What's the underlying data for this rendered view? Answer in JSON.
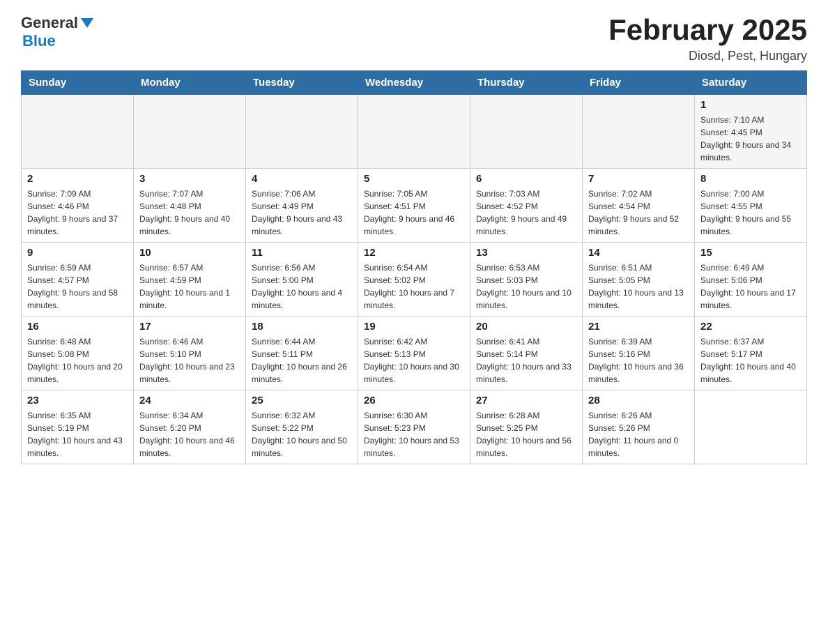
{
  "header": {
    "logo": {
      "general": "General",
      "arrow": "▶",
      "blue": "Blue"
    },
    "title": "February 2025",
    "location": "Diosd, Pest, Hungary"
  },
  "weekdays": [
    "Sunday",
    "Monday",
    "Tuesday",
    "Wednesday",
    "Thursday",
    "Friday",
    "Saturday"
  ],
  "weeks": [
    {
      "days": [
        {
          "number": "",
          "info": ""
        },
        {
          "number": "",
          "info": ""
        },
        {
          "number": "",
          "info": ""
        },
        {
          "number": "",
          "info": ""
        },
        {
          "number": "",
          "info": ""
        },
        {
          "number": "",
          "info": ""
        },
        {
          "number": "1",
          "info": "Sunrise: 7:10 AM\nSunset: 4:45 PM\nDaylight: 9 hours and 34 minutes."
        }
      ]
    },
    {
      "days": [
        {
          "number": "2",
          "info": "Sunrise: 7:09 AM\nSunset: 4:46 PM\nDaylight: 9 hours and 37 minutes."
        },
        {
          "number": "3",
          "info": "Sunrise: 7:07 AM\nSunset: 4:48 PM\nDaylight: 9 hours and 40 minutes."
        },
        {
          "number": "4",
          "info": "Sunrise: 7:06 AM\nSunset: 4:49 PM\nDaylight: 9 hours and 43 minutes."
        },
        {
          "number": "5",
          "info": "Sunrise: 7:05 AM\nSunset: 4:51 PM\nDaylight: 9 hours and 46 minutes."
        },
        {
          "number": "6",
          "info": "Sunrise: 7:03 AM\nSunset: 4:52 PM\nDaylight: 9 hours and 49 minutes."
        },
        {
          "number": "7",
          "info": "Sunrise: 7:02 AM\nSunset: 4:54 PM\nDaylight: 9 hours and 52 minutes."
        },
        {
          "number": "8",
          "info": "Sunrise: 7:00 AM\nSunset: 4:55 PM\nDaylight: 9 hours and 55 minutes."
        }
      ]
    },
    {
      "days": [
        {
          "number": "9",
          "info": "Sunrise: 6:59 AM\nSunset: 4:57 PM\nDaylight: 9 hours and 58 minutes."
        },
        {
          "number": "10",
          "info": "Sunrise: 6:57 AM\nSunset: 4:59 PM\nDaylight: 10 hours and 1 minute."
        },
        {
          "number": "11",
          "info": "Sunrise: 6:56 AM\nSunset: 5:00 PM\nDaylight: 10 hours and 4 minutes."
        },
        {
          "number": "12",
          "info": "Sunrise: 6:54 AM\nSunset: 5:02 PM\nDaylight: 10 hours and 7 minutes."
        },
        {
          "number": "13",
          "info": "Sunrise: 6:53 AM\nSunset: 5:03 PM\nDaylight: 10 hours and 10 minutes."
        },
        {
          "number": "14",
          "info": "Sunrise: 6:51 AM\nSunset: 5:05 PM\nDaylight: 10 hours and 13 minutes."
        },
        {
          "number": "15",
          "info": "Sunrise: 6:49 AM\nSunset: 5:06 PM\nDaylight: 10 hours and 17 minutes."
        }
      ]
    },
    {
      "days": [
        {
          "number": "16",
          "info": "Sunrise: 6:48 AM\nSunset: 5:08 PM\nDaylight: 10 hours and 20 minutes."
        },
        {
          "number": "17",
          "info": "Sunrise: 6:46 AM\nSunset: 5:10 PM\nDaylight: 10 hours and 23 minutes."
        },
        {
          "number": "18",
          "info": "Sunrise: 6:44 AM\nSunset: 5:11 PM\nDaylight: 10 hours and 26 minutes."
        },
        {
          "number": "19",
          "info": "Sunrise: 6:42 AM\nSunset: 5:13 PM\nDaylight: 10 hours and 30 minutes."
        },
        {
          "number": "20",
          "info": "Sunrise: 6:41 AM\nSunset: 5:14 PM\nDaylight: 10 hours and 33 minutes."
        },
        {
          "number": "21",
          "info": "Sunrise: 6:39 AM\nSunset: 5:16 PM\nDaylight: 10 hours and 36 minutes."
        },
        {
          "number": "22",
          "info": "Sunrise: 6:37 AM\nSunset: 5:17 PM\nDaylight: 10 hours and 40 minutes."
        }
      ]
    },
    {
      "days": [
        {
          "number": "23",
          "info": "Sunrise: 6:35 AM\nSunset: 5:19 PM\nDaylight: 10 hours and 43 minutes."
        },
        {
          "number": "24",
          "info": "Sunrise: 6:34 AM\nSunset: 5:20 PM\nDaylight: 10 hours and 46 minutes."
        },
        {
          "number": "25",
          "info": "Sunrise: 6:32 AM\nSunset: 5:22 PM\nDaylight: 10 hours and 50 minutes."
        },
        {
          "number": "26",
          "info": "Sunrise: 6:30 AM\nSunset: 5:23 PM\nDaylight: 10 hours and 53 minutes."
        },
        {
          "number": "27",
          "info": "Sunrise: 6:28 AM\nSunset: 5:25 PM\nDaylight: 10 hours and 56 minutes."
        },
        {
          "number": "28",
          "info": "Sunrise: 6:26 AM\nSunset: 5:26 PM\nDaylight: 11 hours and 0 minutes."
        },
        {
          "number": "",
          "info": ""
        }
      ]
    }
  ]
}
